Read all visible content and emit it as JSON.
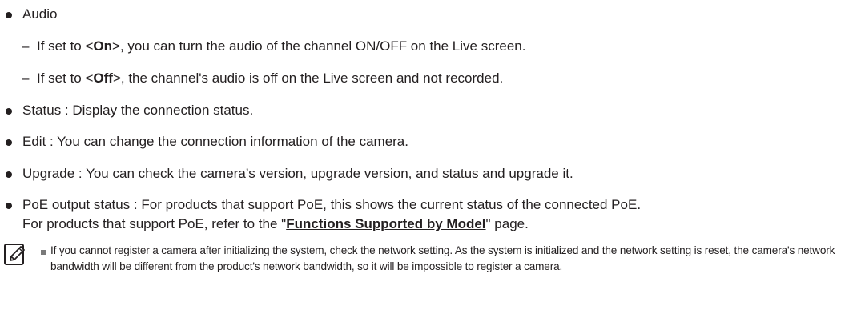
{
  "bullets": {
    "audio": {
      "label": "Audio",
      "on": {
        "dash": "–",
        "prefix": "If set to <",
        "bold": "On",
        "suffix": ">, you can turn the audio of the channel ON/OFF on the Live screen."
      },
      "off": {
        "dash": "–",
        "prefix": "If set to <",
        "bold": "Off",
        "suffix": ">, the channel's audio is off on the Live screen and not recorded."
      }
    },
    "status": "Status : Display the connection status.",
    "edit": "Edit : You can change the connection information of the camera.",
    "upgrade": "Upgrade : You can check the camera’s version, upgrade version, and status and upgrade it.",
    "poe": {
      "line1": "PoE output status : For products that support PoE, this shows the current status of the connected PoE.",
      "line2_prefix": "For products that support PoE, refer to the \"",
      "line2_link": "Functions Supported by Model",
      "line2_suffix": "\" page."
    }
  },
  "note": {
    "icon": "note-pencil-icon",
    "text": "If you cannot register a camera after initializing the system, check the network setting. As the system is initialized and the network setting is reset, the camera's network bandwidth will be different from the product's network bandwidth, so it will be impossible to register a camera."
  }
}
